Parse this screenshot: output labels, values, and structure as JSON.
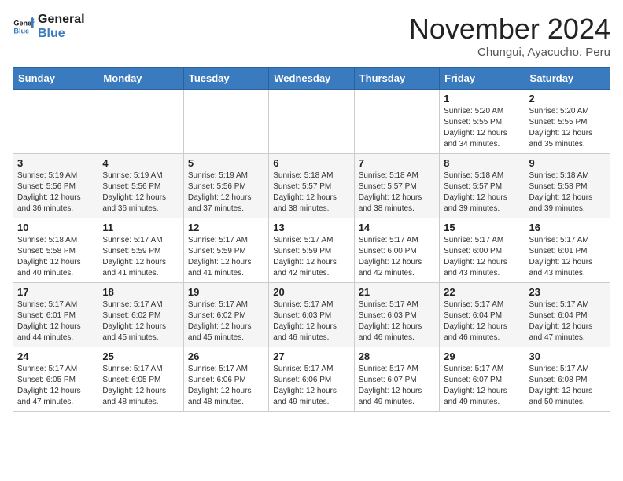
{
  "header": {
    "logo_line1": "General",
    "logo_line2": "Blue",
    "month_title": "November 2024",
    "location": "Chungui, Ayacucho, Peru"
  },
  "weekdays": [
    "Sunday",
    "Monday",
    "Tuesday",
    "Wednesday",
    "Thursday",
    "Friday",
    "Saturday"
  ],
  "weeks": [
    [
      {
        "day": "",
        "info": ""
      },
      {
        "day": "",
        "info": ""
      },
      {
        "day": "",
        "info": ""
      },
      {
        "day": "",
        "info": ""
      },
      {
        "day": "",
        "info": ""
      },
      {
        "day": "1",
        "info": "Sunrise: 5:20 AM\nSunset: 5:55 PM\nDaylight: 12 hours\nand 34 minutes."
      },
      {
        "day": "2",
        "info": "Sunrise: 5:20 AM\nSunset: 5:55 PM\nDaylight: 12 hours\nand 35 minutes."
      }
    ],
    [
      {
        "day": "3",
        "info": "Sunrise: 5:19 AM\nSunset: 5:56 PM\nDaylight: 12 hours\nand 36 minutes."
      },
      {
        "day": "4",
        "info": "Sunrise: 5:19 AM\nSunset: 5:56 PM\nDaylight: 12 hours\nand 36 minutes."
      },
      {
        "day": "5",
        "info": "Sunrise: 5:19 AM\nSunset: 5:56 PM\nDaylight: 12 hours\nand 37 minutes."
      },
      {
        "day": "6",
        "info": "Sunrise: 5:18 AM\nSunset: 5:57 PM\nDaylight: 12 hours\nand 38 minutes."
      },
      {
        "day": "7",
        "info": "Sunrise: 5:18 AM\nSunset: 5:57 PM\nDaylight: 12 hours\nand 38 minutes."
      },
      {
        "day": "8",
        "info": "Sunrise: 5:18 AM\nSunset: 5:57 PM\nDaylight: 12 hours\nand 39 minutes."
      },
      {
        "day": "9",
        "info": "Sunrise: 5:18 AM\nSunset: 5:58 PM\nDaylight: 12 hours\nand 39 minutes."
      }
    ],
    [
      {
        "day": "10",
        "info": "Sunrise: 5:18 AM\nSunset: 5:58 PM\nDaylight: 12 hours\nand 40 minutes."
      },
      {
        "day": "11",
        "info": "Sunrise: 5:17 AM\nSunset: 5:59 PM\nDaylight: 12 hours\nand 41 minutes."
      },
      {
        "day": "12",
        "info": "Sunrise: 5:17 AM\nSunset: 5:59 PM\nDaylight: 12 hours\nand 41 minutes."
      },
      {
        "day": "13",
        "info": "Sunrise: 5:17 AM\nSunset: 5:59 PM\nDaylight: 12 hours\nand 42 minutes."
      },
      {
        "day": "14",
        "info": "Sunrise: 5:17 AM\nSunset: 6:00 PM\nDaylight: 12 hours\nand 42 minutes."
      },
      {
        "day": "15",
        "info": "Sunrise: 5:17 AM\nSunset: 6:00 PM\nDaylight: 12 hours\nand 43 minutes."
      },
      {
        "day": "16",
        "info": "Sunrise: 5:17 AM\nSunset: 6:01 PM\nDaylight: 12 hours\nand 43 minutes."
      }
    ],
    [
      {
        "day": "17",
        "info": "Sunrise: 5:17 AM\nSunset: 6:01 PM\nDaylight: 12 hours\nand 44 minutes."
      },
      {
        "day": "18",
        "info": "Sunrise: 5:17 AM\nSunset: 6:02 PM\nDaylight: 12 hours\nand 45 minutes."
      },
      {
        "day": "19",
        "info": "Sunrise: 5:17 AM\nSunset: 6:02 PM\nDaylight: 12 hours\nand 45 minutes."
      },
      {
        "day": "20",
        "info": "Sunrise: 5:17 AM\nSunset: 6:03 PM\nDaylight: 12 hours\nand 46 minutes."
      },
      {
        "day": "21",
        "info": "Sunrise: 5:17 AM\nSunset: 6:03 PM\nDaylight: 12 hours\nand 46 minutes."
      },
      {
        "day": "22",
        "info": "Sunrise: 5:17 AM\nSunset: 6:04 PM\nDaylight: 12 hours\nand 46 minutes."
      },
      {
        "day": "23",
        "info": "Sunrise: 5:17 AM\nSunset: 6:04 PM\nDaylight: 12 hours\nand 47 minutes."
      }
    ],
    [
      {
        "day": "24",
        "info": "Sunrise: 5:17 AM\nSunset: 6:05 PM\nDaylight: 12 hours\nand 47 minutes."
      },
      {
        "day": "25",
        "info": "Sunrise: 5:17 AM\nSunset: 6:05 PM\nDaylight: 12 hours\nand 48 minutes."
      },
      {
        "day": "26",
        "info": "Sunrise: 5:17 AM\nSunset: 6:06 PM\nDaylight: 12 hours\nand 48 minutes."
      },
      {
        "day": "27",
        "info": "Sunrise: 5:17 AM\nSunset: 6:06 PM\nDaylight: 12 hours\nand 49 minutes."
      },
      {
        "day": "28",
        "info": "Sunrise: 5:17 AM\nSunset: 6:07 PM\nDaylight: 12 hours\nand 49 minutes."
      },
      {
        "day": "29",
        "info": "Sunrise: 5:17 AM\nSunset: 6:07 PM\nDaylight: 12 hours\nand 49 minutes."
      },
      {
        "day": "30",
        "info": "Sunrise: 5:17 AM\nSunset: 6:08 PM\nDaylight: 12 hours\nand 50 minutes."
      }
    ]
  ]
}
